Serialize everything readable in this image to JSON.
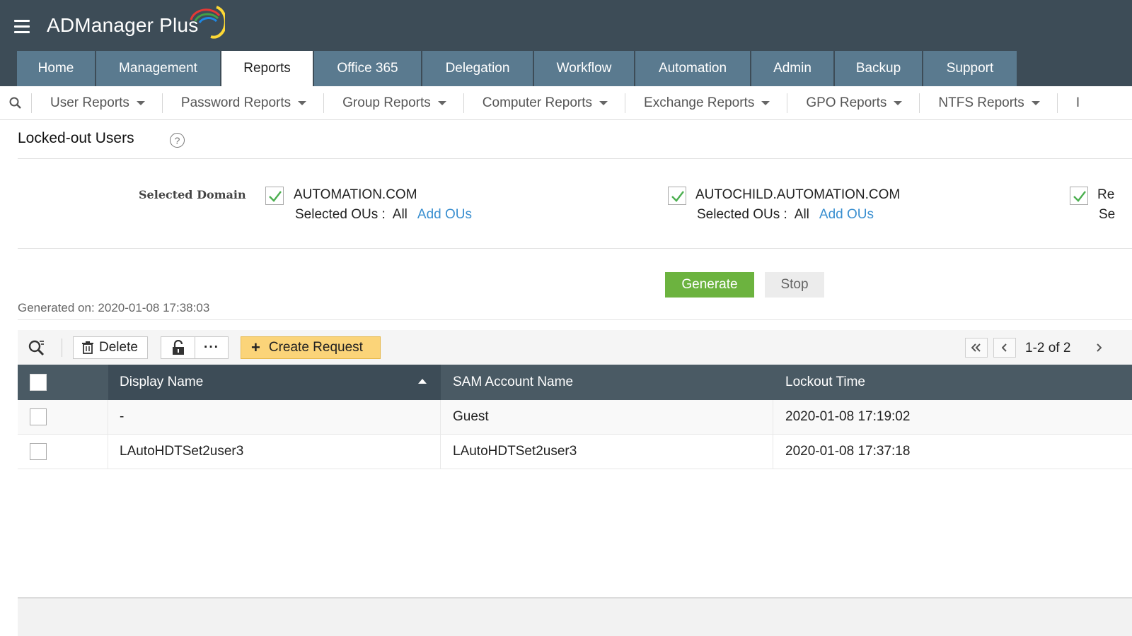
{
  "app": {
    "title": "ADManager Plus",
    "hamburger_icon": "menu-icon"
  },
  "tabs": [
    {
      "label": "Home",
      "active": false
    },
    {
      "label": "Management",
      "active": false
    },
    {
      "label": "Reports",
      "active": true
    },
    {
      "label": "Office 365",
      "active": false
    },
    {
      "label": "Delegation",
      "active": false
    },
    {
      "label": "Workflow",
      "active": false
    },
    {
      "label": "Automation",
      "active": false
    },
    {
      "label": "Admin",
      "active": false
    },
    {
      "label": "Backup",
      "active": false
    },
    {
      "label": "Support",
      "active": false
    }
  ],
  "subnav": {
    "items": [
      "User Reports",
      "Password Reports",
      "Group Reports",
      "Computer Reports",
      "Exchange Reports",
      "GPO Reports",
      "NTFS Reports",
      "I"
    ]
  },
  "page": {
    "title": "Locked-out Users",
    "help_icon": "?"
  },
  "domains": {
    "label": "Selected Domain",
    "list": [
      {
        "name": "AUTOMATION.COM",
        "ou_label": "Selected OUs :",
        "ou_value": "All",
        "add_link": "Add OUs",
        "checked": true
      },
      {
        "name": "AUTOCHILD.AUTOMATION.COM",
        "ou_label": "Selected OUs :",
        "ou_value": "All",
        "add_link": "Add OUs",
        "checked": true
      },
      {
        "name": "Re",
        "ou_label": "Se",
        "checked": true
      }
    ]
  },
  "actions": {
    "generate": "Generate",
    "stop": "Stop"
  },
  "generated_on": "Generated on: 2020-01-08 17:38:03",
  "toolbar": {
    "delete": "Delete",
    "more": "···",
    "create_request": "Create Request",
    "pager": "1-2 of 2"
  },
  "table": {
    "columns": [
      "Display Name",
      "SAM Account Name",
      "Lockout Time"
    ],
    "sort_column": "Display Name",
    "sort_direction": "ascending",
    "rows": [
      {
        "display_name": "-",
        "sam": "Guest",
        "lockout_time": "2020-01-08 17:19:02"
      },
      {
        "display_name": "LAutoHDTSet2user3",
        "sam": "LAutoHDTSet2user3",
        "lockout_time": "2020-01-08 17:37:18"
      }
    ]
  },
  "colors": {
    "header_bg": "#3d4c57",
    "tab_bg": "#5a7a8f",
    "generate_green": "#6cb33f",
    "create_request_yellow": "#fbd479",
    "link_blue": "#3a8fd0",
    "check_green": "#4caf50"
  }
}
